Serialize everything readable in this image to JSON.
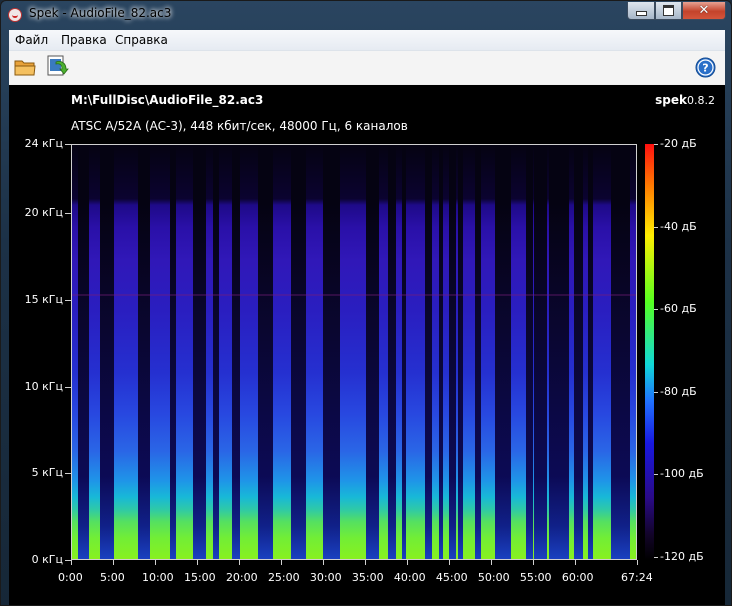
{
  "window": {
    "title": "Spek - AudioFile_82.ac3",
    "minimize_symbol": "",
    "maximize_symbol": "",
    "close_symbol": "✕"
  },
  "menu": [
    {
      "label": "Файл"
    },
    {
      "label": "Правка"
    },
    {
      "label": "Справка"
    }
  ],
  "toolbar": {
    "open_icon": "open-folder-icon",
    "save_icon": "save-image-icon",
    "help_icon": "help-icon"
  },
  "spectrogram": {
    "file_path": "M:\\FullDisc\\AudioFile_82.ac3",
    "app_name": "spek",
    "app_version": "0.8.2",
    "file_info": "ATSC A/52A (AC-3), 448 кбит/сек, 48000 Гц, 6 каналов",
    "y_axis_ticks": [
      "24 кГц",
      "20 кГц",
      "15 кГц",
      "10 кГц",
      "5 кГц",
      "0 кГц"
    ],
    "x_axis_ticks": [
      "0:00",
      "5:00",
      "10:00",
      "15:00",
      "20:00",
      "25:00",
      "30:00",
      "35:00",
      "40:00",
      "45:00",
      "50:00",
      "55:00",
      "60:00",
      "67:24"
    ],
    "colorbar_ticks": [
      "-20 дБ",
      "-40 дБ",
      "-60 дБ",
      "-80 дБ",
      "-100 дБ",
      "-120 дБ"
    ],
    "colors": {
      "background": "#000000",
      "text": "#ffffff",
      "menu_bg": "#f0f0f0"
    }
  }
}
